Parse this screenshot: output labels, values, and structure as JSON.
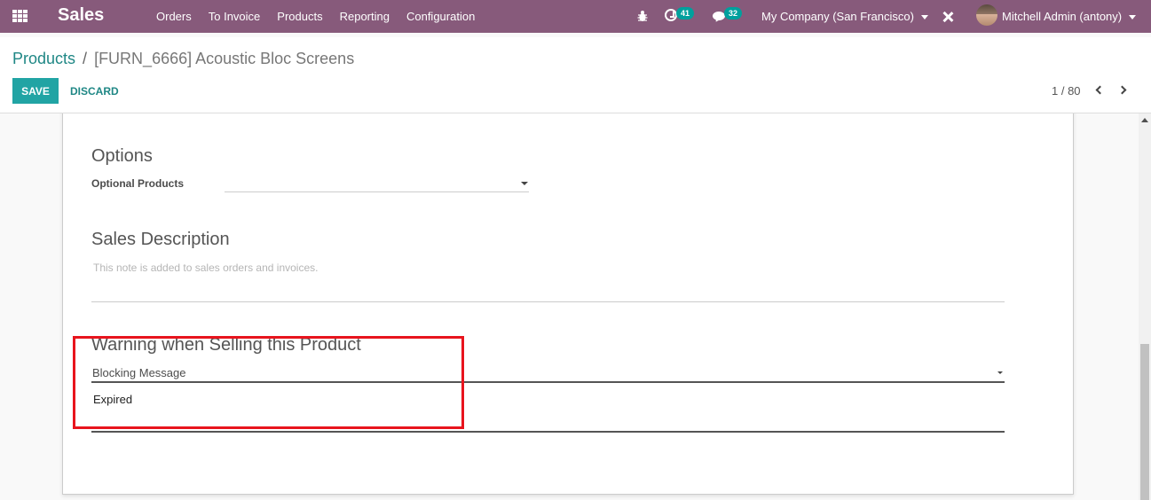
{
  "navbar": {
    "app_name": "Sales",
    "menu": [
      "Orders",
      "To Invoice",
      "Products",
      "Reporting",
      "Configuration"
    ],
    "activity_count": "41",
    "message_count": "32",
    "company": "My Company (San Francisco)",
    "user": "Mitchell Admin (antony)",
    "icons": [
      "apps-grid-icon",
      "bug-icon",
      "activity-clock-icon",
      "chat-icon",
      "tools-icon"
    ]
  },
  "breadcrumb": {
    "parent": "Products",
    "separator": "/",
    "current": "[FURN_6666] Acoustic Bloc Screens"
  },
  "actions": {
    "save": "SAVE",
    "discard": "DISCARD"
  },
  "pager": {
    "value": "1 / 80"
  },
  "form": {
    "options": {
      "title": "Options",
      "optional_products_label": "Optional Products",
      "optional_products_value": ""
    },
    "sales_description": {
      "title": "Sales Description",
      "placeholder": "This note is added to sales orders and invoices."
    },
    "warning": {
      "title": "Warning when Selling this Product",
      "selected": "Blocking Message",
      "message": "Expired"
    }
  },
  "colors": {
    "navbar": "#875a7b",
    "primary": "#21a4a4",
    "link": "#1f8785",
    "highlight": "#e8141d",
    "badge": "#00a09d"
  }
}
